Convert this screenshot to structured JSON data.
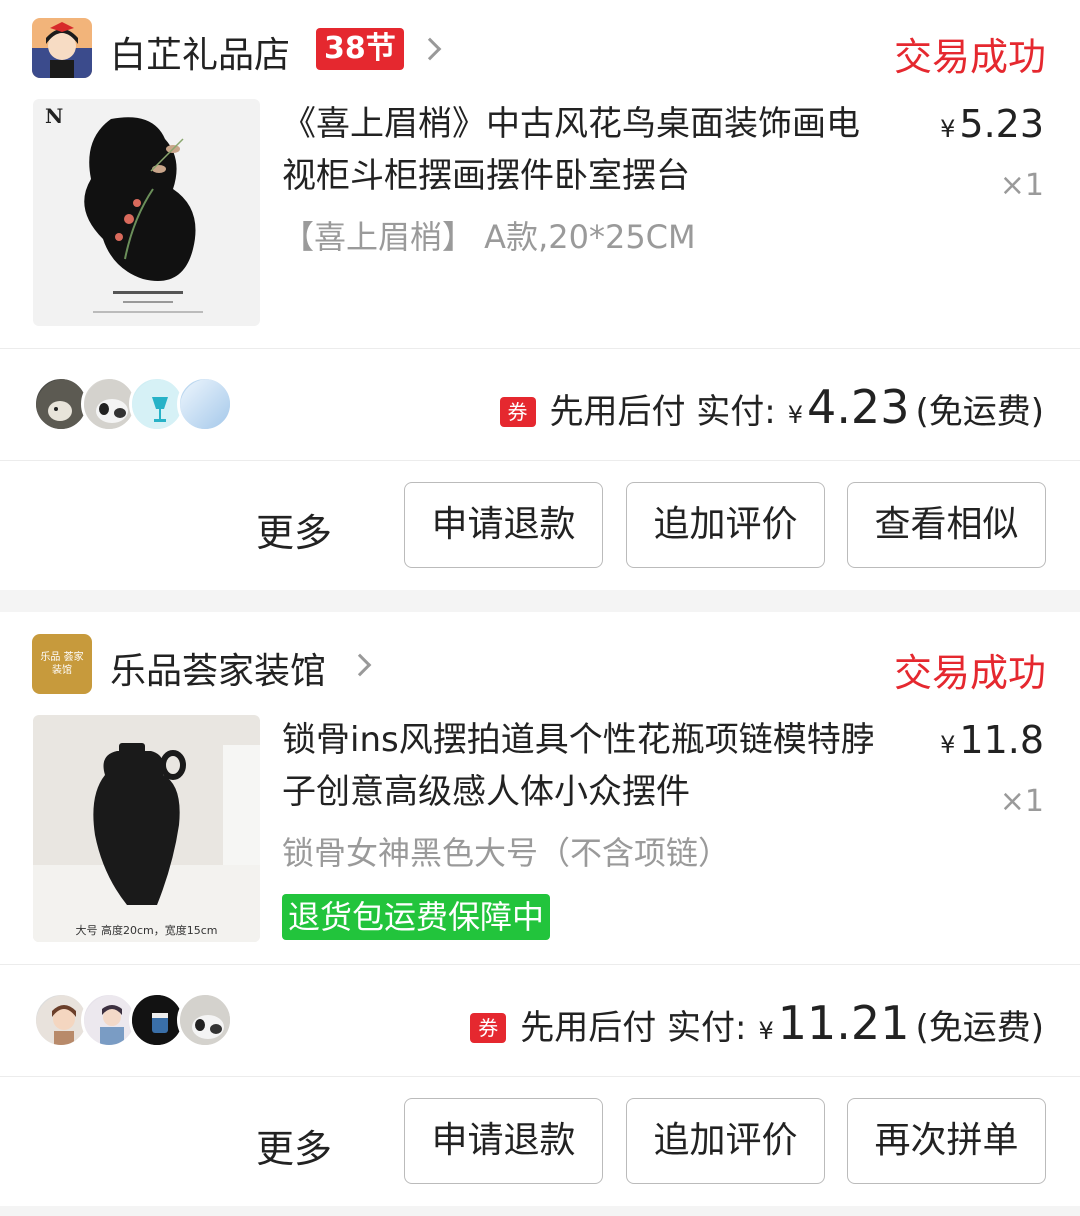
{
  "orders": [
    {
      "shop_name": "白芷礼品店",
      "shop_badge": "38节",
      "status": "交易成功",
      "title": "《喜上眉梢》中古风花鸟桌面装饰画电视柜斗柜摆画摆件卧室摆台",
      "spec": "【喜上眉梢】 A款,20*25CM",
      "currency": "¥",
      "price": "5.23",
      "quantity": "×1",
      "coupon_icon": "券",
      "pay_label": "先用后付 实付:",
      "paid_amount": "4.23",
      "shipping_note": "(免运费)",
      "actions": {
        "more": "更多",
        "b1": "申请退款",
        "b2": "追加评价",
        "b3": "查看相似"
      }
    },
    {
      "shop_name": "乐品荟家装馆",
      "shop_logo_text": "乐品 荟家装馆",
      "status": "交易成功",
      "title": "锁骨ins风摆拍道具个性花瓶项链模特脖子创意高级感人体小众摆件",
      "spec": "锁骨女神黑色大号（不含项链）",
      "guarantee": "退货包运费保障中",
      "image_caption": "大号 高度20cm，宽度15cm",
      "currency": "¥",
      "price": "11.8",
      "quantity": "×1",
      "coupon_icon": "券",
      "pay_label": "先用后付 实付:",
      "paid_amount": "11.21",
      "shipping_note": "(免运费)",
      "actions": {
        "more": "更多",
        "b1": "申请退款",
        "b2": "追加评价",
        "b3": "再次拼单"
      }
    }
  ],
  "colors": {
    "status_red": "#e5282f",
    "guarantee_green": "#22c43c"
  }
}
